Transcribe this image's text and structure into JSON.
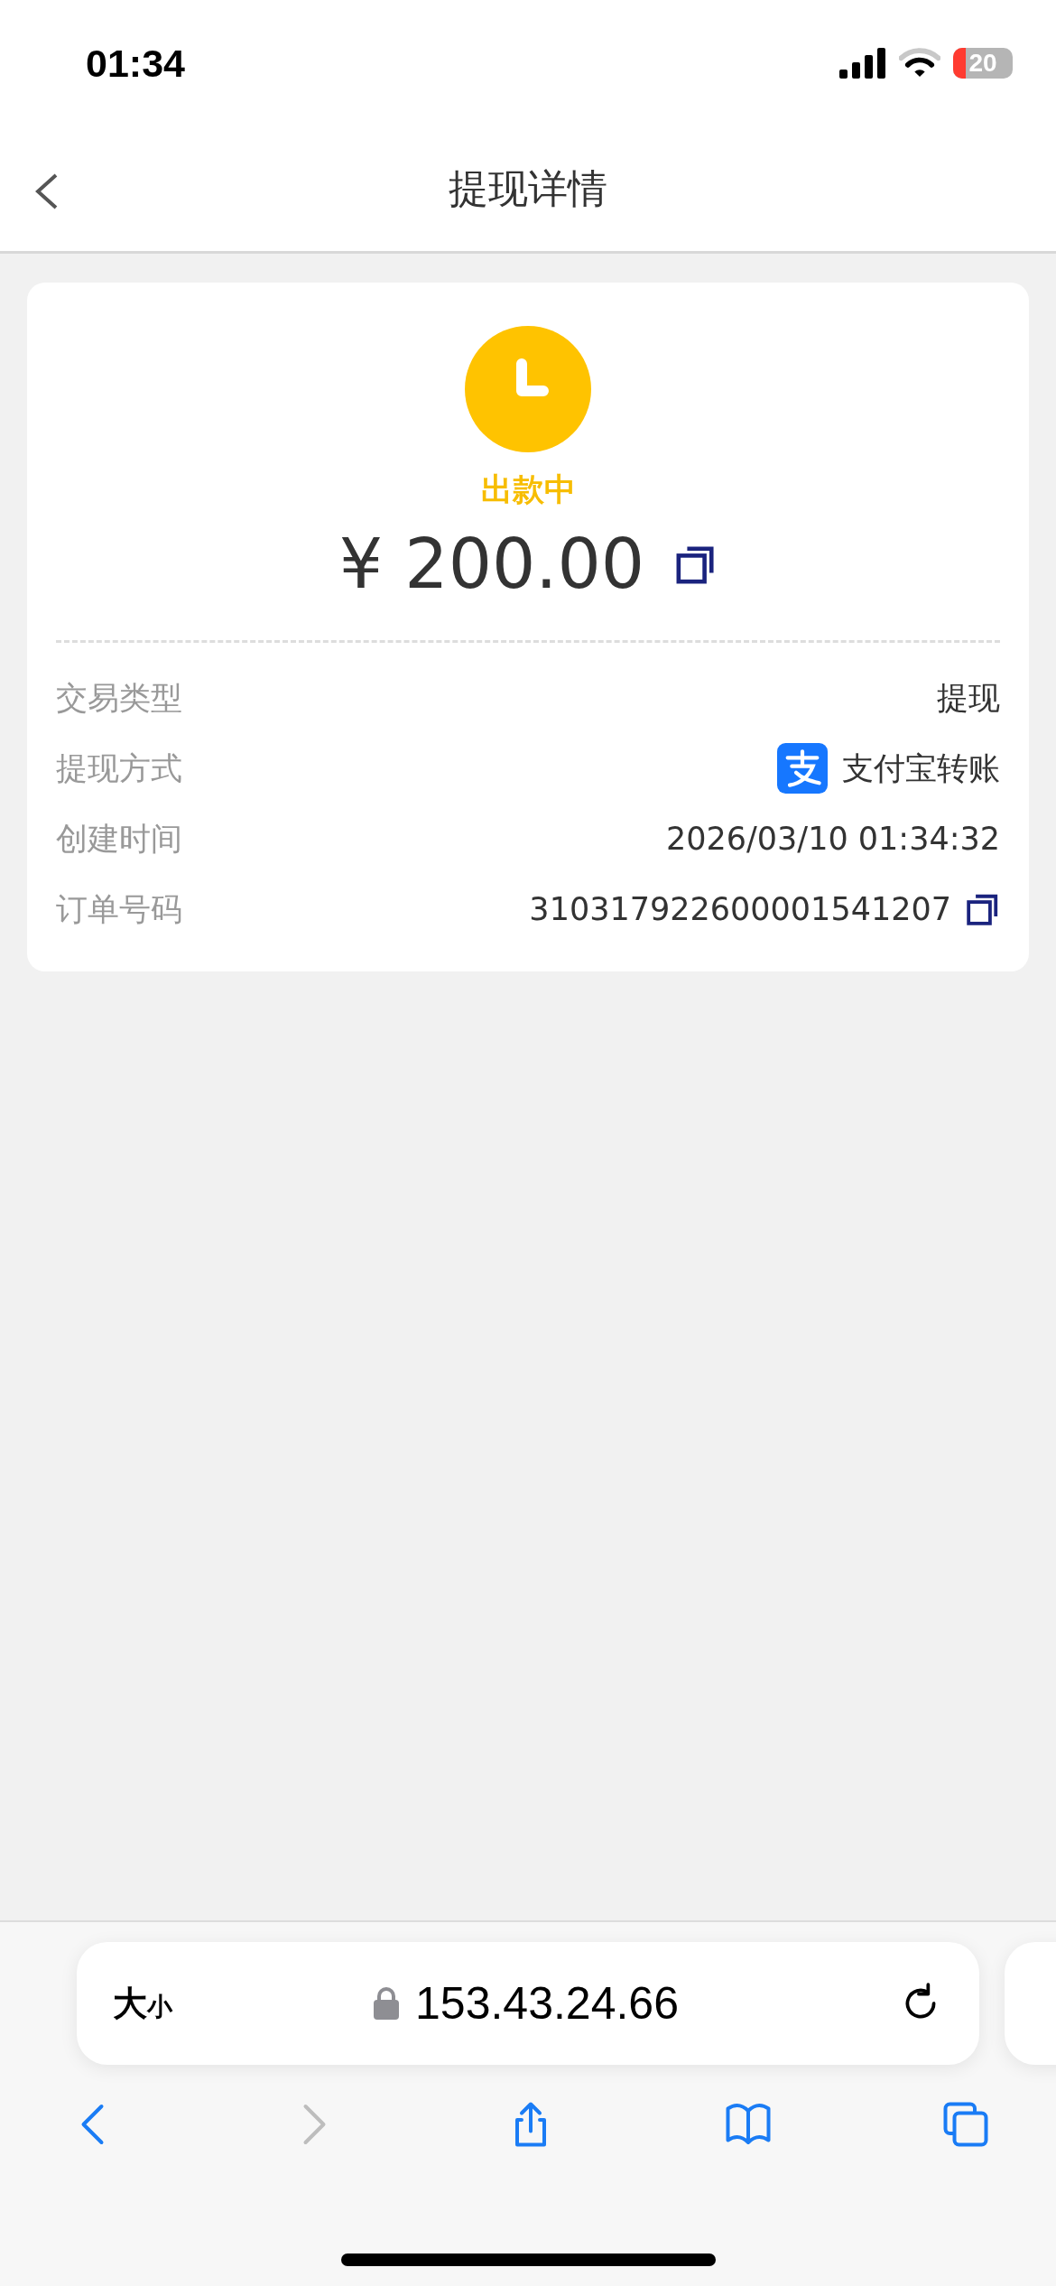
{
  "status_bar": {
    "time": "01:34",
    "battery": "20"
  },
  "header": {
    "title": "提现详情"
  },
  "summary": {
    "status": "出款中",
    "amount": "¥ 200.00"
  },
  "details": [
    {
      "label": "交易类型",
      "value": "提现",
      "kind": "text"
    },
    {
      "label": "提现方式",
      "value": "支付宝转账",
      "kind": "payment"
    },
    {
      "label": "创建时间",
      "value": "2026/03/10 01:34:32",
      "kind": "text"
    },
    {
      "label": "订单号码",
      "value": "310317922600001541207",
      "kind": "copy"
    }
  ],
  "browser": {
    "text_size": {
      "large": "大",
      "small": "小"
    },
    "address": "153.43.24.66",
    "toolbar": [
      {
        "kind": "back",
        "disabled": false
      },
      {
        "kind": "forward",
        "disabled": true
      },
      {
        "kind": "share",
        "disabled": false
      },
      {
        "kind": "bookmarks",
        "disabled": false
      },
      {
        "kind": "tabs",
        "disabled": false
      }
    ]
  }
}
